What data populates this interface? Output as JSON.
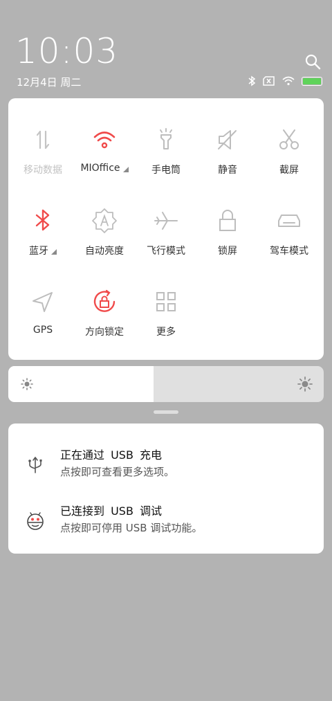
{
  "status": {
    "time": "10:03",
    "date": "12月4日 周二",
    "battery_color": "#5fd35a"
  },
  "tiles": [
    {
      "label": "移动数据",
      "icon": "mobile-data-icon",
      "active": false,
      "dim": true
    },
    {
      "label": "MIOffice",
      "icon": "wifi-icon",
      "active": true,
      "dim": false,
      "expand": true
    },
    {
      "label": "手电筒",
      "icon": "flashlight-icon",
      "active": false
    },
    {
      "label": "静音",
      "icon": "mute-icon",
      "active": false
    },
    {
      "label": "截屏",
      "icon": "screenshot-icon",
      "active": false
    },
    {
      "label": "蓝牙",
      "icon": "bluetooth-icon",
      "active": true,
      "expand": true
    },
    {
      "label": "自动亮度",
      "icon": "auto-brightness-icon",
      "active": false
    },
    {
      "label": "飞行模式",
      "icon": "airplane-icon",
      "active": false
    },
    {
      "label": "锁屏",
      "icon": "lock-icon",
      "active": false
    },
    {
      "label": "驾车模式",
      "icon": "car-icon",
      "active": false
    },
    {
      "label": "GPS",
      "icon": "gps-icon",
      "active": false
    },
    {
      "label": "方向锁定",
      "icon": "rotation-lock-icon",
      "active": true
    },
    {
      "label": "更多",
      "icon": "more-grid-icon",
      "active": false
    }
  ],
  "brightness": {
    "level": 0.46
  },
  "notifications": [
    {
      "title": "正在通过 USB 充电",
      "subtitle": "点按即可查看更多选项。",
      "icon": "usb-icon"
    },
    {
      "title": "已连接到 USB 调试",
      "subtitle": "点按即可停用 USB 调试功能。",
      "icon": "android-debug-icon"
    }
  ],
  "colors": {
    "accent": "#f04a4a",
    "icon_inactive": "#b8b8b8",
    "panel_bg": "#ffffff",
    "shade_bg": "#b3b3b3"
  }
}
